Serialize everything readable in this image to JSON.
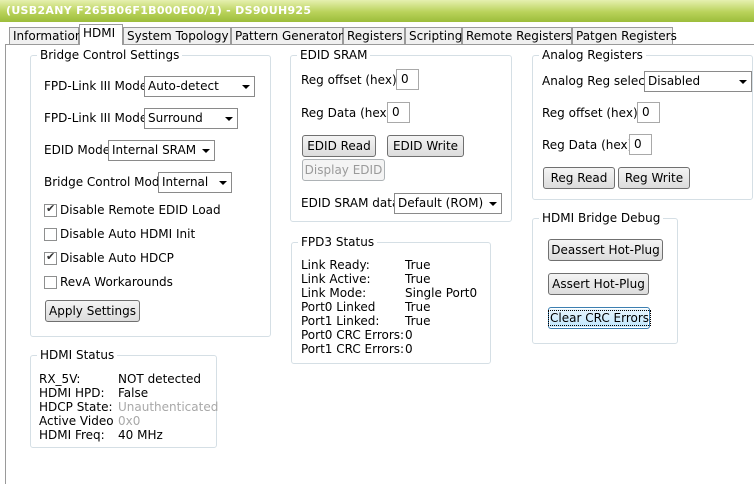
{
  "window": {
    "title": "(USB2ANY F265B06F1B000E00/1) - DS90UH925"
  },
  "tabs": [
    {
      "label": "Information"
    },
    {
      "label": "HDMI"
    },
    {
      "label": "System Topology"
    },
    {
      "label": "Pattern Generator"
    },
    {
      "label": "Registers"
    },
    {
      "label": "Scripting"
    },
    {
      "label": "Remote Registers"
    },
    {
      "label": "Patgen Registers"
    }
  ],
  "bridge_control": {
    "title": "Bridge Control Settings",
    "fpd_mode_1_label": "FPD-Link III Mode",
    "fpd_mode_1_value": "Auto-detect",
    "fpd_mode_2_label": "FPD-Link III Mode",
    "fpd_mode_2_value": "Surround",
    "edid_mode_label": "EDID Mode",
    "edid_mode_value": "Internal SRAM",
    "bridge_mode_label": "Bridge Control Mode",
    "bridge_mode_value": "Internal",
    "checkboxes": [
      {
        "label": "Disable Remote EDID Load",
        "checked": true
      },
      {
        "label": "Disable Auto HDMI Init",
        "checked": false
      },
      {
        "label": "Disable Auto HDCP",
        "checked": true
      },
      {
        "label": "RevA Workarounds",
        "checked": false
      }
    ],
    "apply_label": "Apply Settings"
  },
  "edid_sram": {
    "title": "EDID SRAM",
    "reg_offset_label": "Reg offset (hex)",
    "reg_offset_value": "0",
    "reg_data_label": "Reg Data (hex)",
    "reg_data_value": "0",
    "read_label": "EDID Read",
    "write_label": "EDID Write",
    "display_label": "Display EDID",
    "sram_data_label": "EDID SRAM data",
    "sram_data_value": "Default (ROM)"
  },
  "analog": {
    "title": "Analog Registers",
    "select_label": "Analog Reg select",
    "select_value": "Disabled",
    "reg_offset_label": "Reg offset (hex)",
    "reg_offset_value": "0",
    "reg_data_label": "Reg Data (hex)",
    "reg_data_value": "0",
    "read_label": "Reg Read",
    "write_label": "Reg Write"
  },
  "hdmi_debug": {
    "title": "HDMI Bridge Debug",
    "deassert_label": "Deassert Hot-Plug",
    "assert_label": "Assert Hot-Plug",
    "clear_label": "Clear CRC Errors"
  },
  "fpd3_status": {
    "title": "FPD3 Status",
    "rows": [
      {
        "label": "Link Ready:",
        "value": "True"
      },
      {
        "label": "Link Active:",
        "value": "True"
      },
      {
        "label": "Link Mode:",
        "value": "Single Port0"
      },
      {
        "label": "Port0 Linked",
        "value": "True"
      },
      {
        "label": "Port1 Linked:",
        "value": "True"
      },
      {
        "label": "Port0 CRC Errors:",
        "value": "0"
      },
      {
        "label": "Port1 CRC Errors:",
        "value": "0"
      }
    ]
  },
  "hdmi_status": {
    "title": "HDMI Status",
    "rows": [
      {
        "label": "RX_5V:",
        "value": "NOT detected",
        "disabled": false
      },
      {
        "label": "HDMI HPD:",
        "value": "False",
        "disabled": false
      },
      {
        "label": "HDCP State:",
        "value": "Unauthenticated",
        "disabled": true
      },
      {
        "label": "Active Video",
        "value": "0x0",
        "disabled": true
      },
      {
        "label": "HDMI Freq:",
        "value": "40 MHz",
        "disabled": false
      }
    ]
  }
}
